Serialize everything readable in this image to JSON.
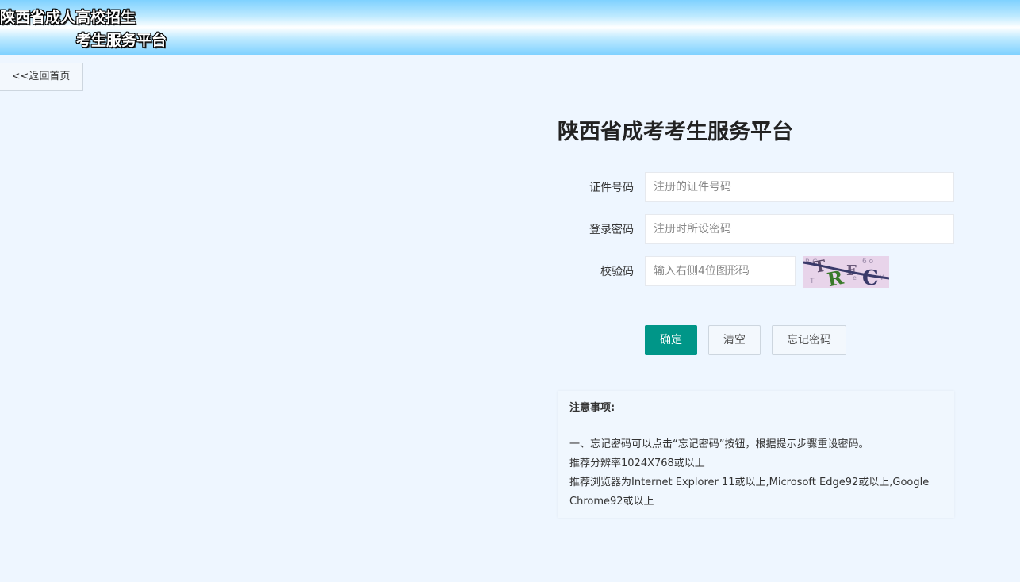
{
  "header": {
    "banner_line1": "陕西省成人高校招生",
    "banner_line2": "考生服务平台"
  },
  "nav": {
    "back_label": "<<返回首页"
  },
  "form": {
    "title": "陕西省成考考生服务平台",
    "id_label": "证件号码",
    "id_placeholder": "注册的证件号码",
    "password_label": "登录密码",
    "password_placeholder": "注册时所设密码",
    "captcha_label": "校验码",
    "captcha_placeholder": "输入右侧4位图形码",
    "captcha_text": "TRFC"
  },
  "buttons": {
    "confirm": "确定",
    "clear": "清空",
    "forgot": "忘记密码"
  },
  "notice": {
    "title": "注意事项:",
    "lines": [
      "一、忘记密码可以点击“忘记密码”按钮，根据提示步骤重设密码。",
      "推荐分辨率1024X768或以上",
      "推荐浏览器为Internet Explorer 11或以上,Microsoft Edge92或以上,Google Chrome92或以上"
    ]
  },
  "colors": {
    "page_bg": "#eef6ff",
    "primary": "#009688",
    "banner_blue": "#7fd1ff"
  }
}
